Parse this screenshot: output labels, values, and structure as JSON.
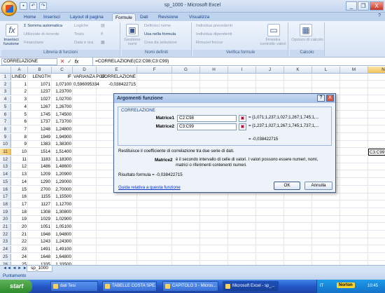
{
  "window": {
    "title": "sp_1000 - Microsoft Excel",
    "minimize": "_",
    "restore": "❐",
    "close": "X"
  },
  "ribbon": {
    "tabs": [
      "Home",
      "Inserisci",
      "Layout di pagina",
      "Formule",
      "Dati",
      "Revisione",
      "Visualizza"
    ],
    "active_tab": "Formule",
    "groups": {
      "library": {
        "label": "Libreria di funzioni",
        "insert_function": "Inserisci funzione",
        "items": [
          "Σ Somma automatica",
          "Utilizzate di recente",
          "Finanziarie",
          "Logiche",
          "Testo",
          "Data e ora",
          "Ricerca e riferimento",
          "Matematiche e trig.",
          "Altre funzioni"
        ]
      },
      "names": {
        "label": "Nomi definiti",
        "name_manager": "Gestione nomi",
        "items": [
          "Definisci nome",
          "Usa nella formula",
          "Crea da selezione"
        ]
      },
      "audit": {
        "label": "Verifica formule",
        "items": [
          "Individua precedenti",
          "Individua dipendenti",
          "Rimuovi frecce",
          "Finestra controllo valori"
        ]
      },
      "calc": {
        "label": "Calcolo",
        "items": [
          "Opzioni di calcolo"
        ]
      }
    }
  },
  "formula_bar": {
    "name_box": "CORRELAZIONE",
    "cancel": "✕",
    "enter": "✓",
    "fx": "fx",
    "formula": "=CORRELAZIONE(C2:C98;C3:C99)"
  },
  "columns": [
    "A",
    "B",
    "C",
    "D",
    "E",
    "F",
    "G",
    "H",
    "I",
    "J",
    "K",
    "L",
    "M",
    "N"
  ],
  "selected_column": "N",
  "selected_row": "11",
  "headers": [
    "LINEID",
    "LENGTH",
    "IF",
    "VARIANZA POP.",
    "CORRELAZIONE"
  ],
  "rows": [
    {
      "n": "2",
      "a": "1",
      "b": "1071",
      "c": "1,07100",
      "d": "0,596095334",
      "e": "-0,038422715"
    },
    {
      "n": "3",
      "a": "2",
      "b": "1237",
      "c": "1,23700"
    },
    {
      "n": "4",
      "a": "3",
      "b": "1027",
      "c": "1,02700"
    },
    {
      "n": "5",
      "a": "4",
      "b": "1267",
      "c": "1,26700"
    },
    {
      "n": "6",
      "a": "5",
      "b": "1745",
      "c": "1,74500"
    },
    {
      "n": "7",
      "a": "6",
      "b": "1737",
      "c": "1,73700"
    },
    {
      "n": "8",
      "a": "7",
      "b": "1248",
      "c": "1,24800"
    },
    {
      "n": "9",
      "a": "8",
      "b": "1949",
      "c": "1,94900"
    },
    {
      "n": "10",
      "a": "9",
      "b": "1383",
      "c": "1,38300"
    },
    {
      "n": "11",
      "a": "10",
      "b": "1514",
      "c": "1,51400"
    },
    {
      "n": "12",
      "a": "11",
      "b": "1183",
      "c": "1,18300"
    },
    {
      "n": "13",
      "a": "12",
      "b": "1486",
      "c": "1,48600"
    },
    {
      "n": "14",
      "a": "13",
      "b": "1209",
      "c": "1,20900"
    },
    {
      "n": "15",
      "a": "14",
      "b": "1290",
      "c": "1,29000"
    },
    {
      "n": "16",
      "a": "15",
      "b": "2700",
      "c": "2,70000"
    },
    {
      "n": "17",
      "a": "16",
      "b": "1155",
      "c": "1,15500"
    },
    {
      "n": "18",
      "a": "17",
      "b": "1127",
      "c": "1,12700"
    },
    {
      "n": "19",
      "a": "18",
      "b": "1308",
      "c": "1,30800"
    },
    {
      "n": "20",
      "a": "19",
      "b": "1029",
      "c": "1,02900"
    },
    {
      "n": "21",
      "a": "20",
      "b": "1051",
      "c": "1,05100"
    },
    {
      "n": "22",
      "a": "21",
      "b": "1948",
      "c": "1,94800"
    },
    {
      "n": "23",
      "a": "22",
      "b": "1243",
      "c": "1,24300"
    },
    {
      "n": "24",
      "a": "23",
      "b": "1491",
      "c": "1,49100"
    },
    {
      "n": "25",
      "a": "24",
      "b": "1648",
      "c": "1,64800"
    },
    {
      "n": "26",
      "a": "25",
      "b": "1335",
      "c": "1,33500"
    }
  ],
  "active_cell_text": "C3:C99)",
  "dialog": {
    "title": "Argomenti funzione",
    "help": "?",
    "close": "X",
    "function_name": "CORRELAZIONE",
    "arg1_label": "Matrice1",
    "arg1_value": "C2:C98",
    "arg1_preview": "= {1,071;1,237;1,027;1,267;1,745;1,...",
    "arg2_label": "Matrice2",
    "arg2_value": "C3:C99",
    "arg2_preview": "= {1,237;1,027;1,267;1,745;1,737;1,...",
    "result_preview": "= -0,038422715",
    "description": "Restituisce il coefficiente di correlazione tra due serie di dati.",
    "arg_help_label": "Matrice2",
    "arg_help_text": "è il secondo intervallo di celle di valori. I valori possono essere numeri, nomi, matrici o riferimenti contenenti numeri.",
    "result_label": "Risultato formula = -0,038422715",
    "help_link": "Guida relativa a questa funzione",
    "ok": "OK",
    "cancel": "Annulla"
  },
  "sheet_tabs": [
    "sp_1000"
  ],
  "status": "Puntamento",
  "taskbar": {
    "start": "start",
    "tasks": [
      "dati Tesi",
      "TABELLE COSTA SPE...",
      "CAPITOLO 3 - Micros...",
      "Microsoft Excel - sp_..."
    ],
    "lang": "IT",
    "norton": "Norton",
    "clock": "10:45"
  }
}
